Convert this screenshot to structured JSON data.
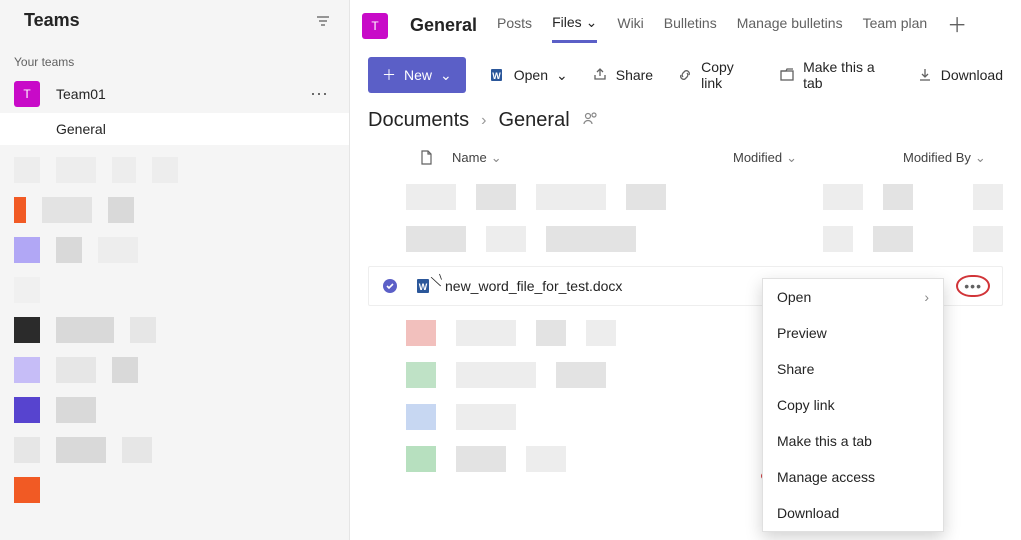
{
  "sidebar": {
    "title": "Teams",
    "your_teams_label": "Your teams",
    "team_initial": "T",
    "team_name": "Team01",
    "team_more": "⋯",
    "channel_name": "General"
  },
  "header": {
    "team_initial": "T",
    "channel_name": "General",
    "tabs": {
      "posts": "Posts",
      "files": "Files",
      "wiki": "Wiki",
      "bulletins": "Bulletins",
      "manage_bulletins": "Manage bulletins",
      "team_plan": "Team plan"
    }
  },
  "toolbar": {
    "new": "New",
    "open": "Open",
    "share": "Share",
    "copy_link": "Copy link",
    "make_tab": "Make this a tab",
    "download": "Download"
  },
  "breadcrumb": {
    "root": "Documents",
    "current": "General"
  },
  "columns": {
    "name": "Name",
    "modified": "Modified",
    "modified_by": "Modified By"
  },
  "file": {
    "name": "new_word_file_for_test.docx"
  },
  "context_menu": {
    "open": "Open",
    "preview": "Preview",
    "share": "Share",
    "copy_link": "Copy link",
    "make_tab": "Make this a tab",
    "manage_access": "Manage access",
    "download": "Download"
  }
}
